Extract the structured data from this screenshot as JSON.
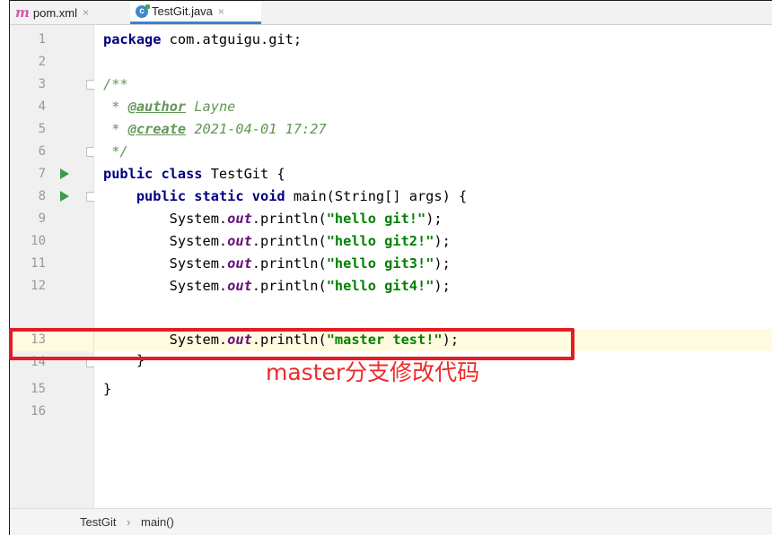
{
  "tabs": [
    {
      "icon": "m",
      "label": "pom.xml",
      "close": "×"
    },
    {
      "icon": "c",
      "label": "TestGit.java",
      "close": "×"
    }
  ],
  "code_lines": [
    {
      "num": "1"
    },
    {
      "num": "2"
    },
    {
      "num": "3"
    },
    {
      "num": "4"
    },
    {
      "num": "5"
    },
    {
      "num": "6"
    },
    {
      "num": "7"
    },
    {
      "num": "8"
    },
    {
      "num": "9"
    },
    {
      "num": "10"
    },
    {
      "num": "11"
    },
    {
      "num": "12"
    },
    {
      "num": "13"
    },
    {
      "num": "14"
    },
    {
      "num": "15"
    },
    {
      "num": "16"
    }
  ],
  "code": {
    "l1_kw": "package",
    "l1_rest": " com.atguigu.git;",
    "l3": "/**",
    "l4_star": " * ",
    "l4_tag": "@author",
    "l4_val": " Layne",
    "l5_star": " * ",
    "l5_tag": "@create",
    "l5_val": " 2021-04-01 17:27",
    "l6": " */",
    "l7_kw": "public class",
    "l7_rest": " TestGit {",
    "l8_indent": "    ",
    "l8_kw": "public static void",
    "l8_rest": " main(String[] args) {",
    "sys": "        System.",
    "out": "out",
    "println": ".println(",
    "close_paren": ");",
    "s9": "\"hello git!\"",
    "s10": "\"hello git2!\"",
    "s11": "\"hello git3!\"",
    "s12": "\"hello git4!\"",
    "s13": "\"master test!\"",
    "l14": "    }",
    "l15": "}"
  },
  "annotation": {
    "text": "master分支修改代码",
    "color": "#e51c23"
  },
  "breadcrumb": {
    "item1": "TestGit",
    "sep": "›",
    "item2": "main()"
  },
  "colors": {
    "keyword": "#000080",
    "string": "#008000",
    "field": "#660e7a",
    "doc": "#629755",
    "highlight_line": "#fffbe0"
  }
}
